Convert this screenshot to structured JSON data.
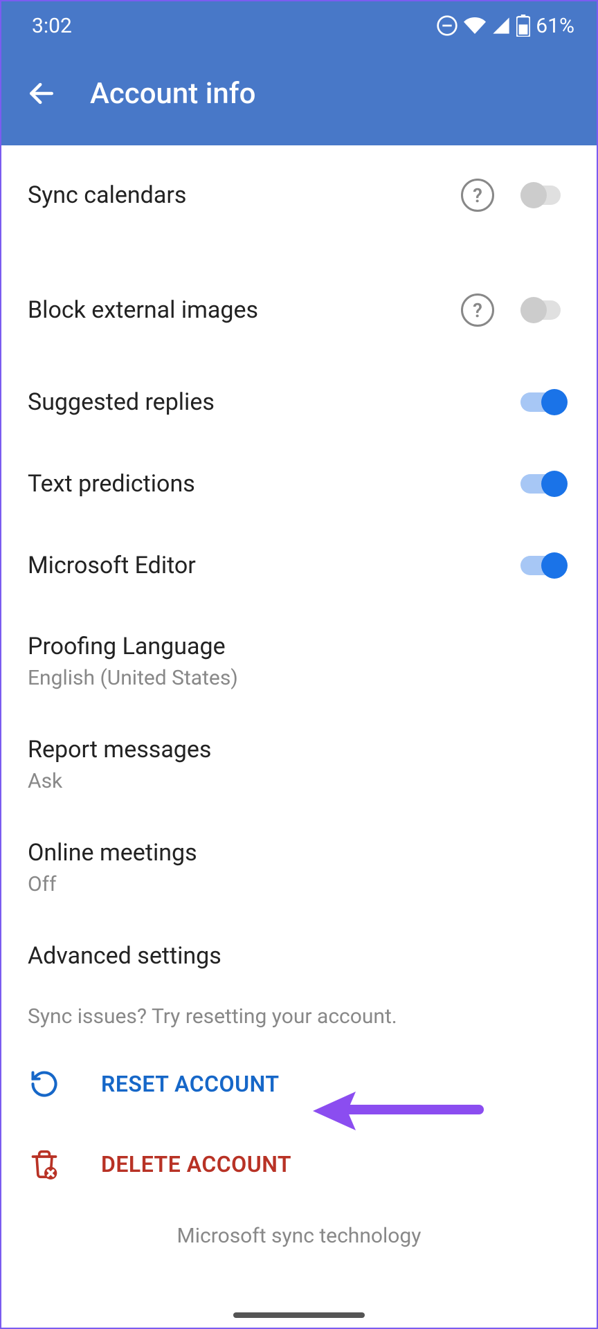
{
  "status": {
    "time": "3:02",
    "battery": "61%"
  },
  "header": {
    "title": "Account info"
  },
  "settings": {
    "sync_calendars": {
      "label": "Sync calendars",
      "on": false,
      "help": true
    },
    "block_external_images": {
      "label": "Block external images",
      "on": false,
      "help": true
    },
    "suggested_replies": {
      "label": "Suggested replies",
      "on": true
    },
    "text_predictions": {
      "label": "Text predictions",
      "on": true
    },
    "microsoft_editor": {
      "label": "Microsoft Editor",
      "on": true
    },
    "proofing_language": {
      "label": "Proofing Language",
      "value": "English (United States)"
    },
    "report_messages": {
      "label": "Report messages",
      "value": "Ask"
    },
    "online_meetings": {
      "label": "Online meetings",
      "value": "Off"
    },
    "advanced_settings": {
      "label": "Advanced settings"
    }
  },
  "hint": "Sync issues? Try resetting your account.",
  "actions": {
    "reset": "RESET ACCOUNT",
    "delete": "DELETE ACCOUNT"
  },
  "footer": "Microsoft sync technology"
}
